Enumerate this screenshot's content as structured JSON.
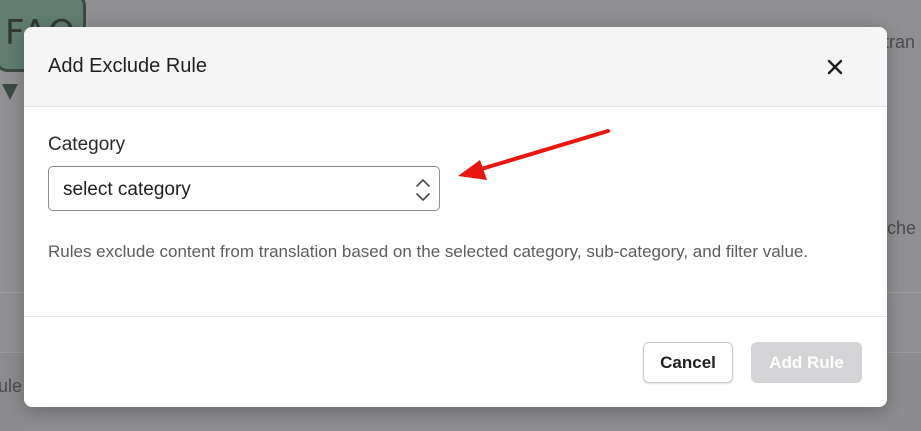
{
  "background": {
    "partial_text_right_top": "tran",
    "partial_text_right_mid": "tche",
    "partial_text_left_bottom": "ule",
    "logo_text": "FAQ"
  },
  "modal": {
    "title": "Add Exclude Rule",
    "close_icon": "close-icon",
    "category_label": "Category",
    "category_select": {
      "selected_value": "select category",
      "icon": "chevron-up-down-icon"
    },
    "help_text": "Rules exclude content from translation based on the selected category, sub-category, and filter value.",
    "cancel_label": "Cancel",
    "add_label": "Add Rule",
    "add_disabled": true
  },
  "annotation": {
    "type": "red-arrow",
    "color": "#e8160c",
    "points_to": "category-select"
  },
  "colors": {
    "overlay": "#8f8f92",
    "modal_header_bg": "#f5f5f5",
    "disabled_button_bg": "#d4d4d6",
    "select_border": "#8d8d92"
  }
}
